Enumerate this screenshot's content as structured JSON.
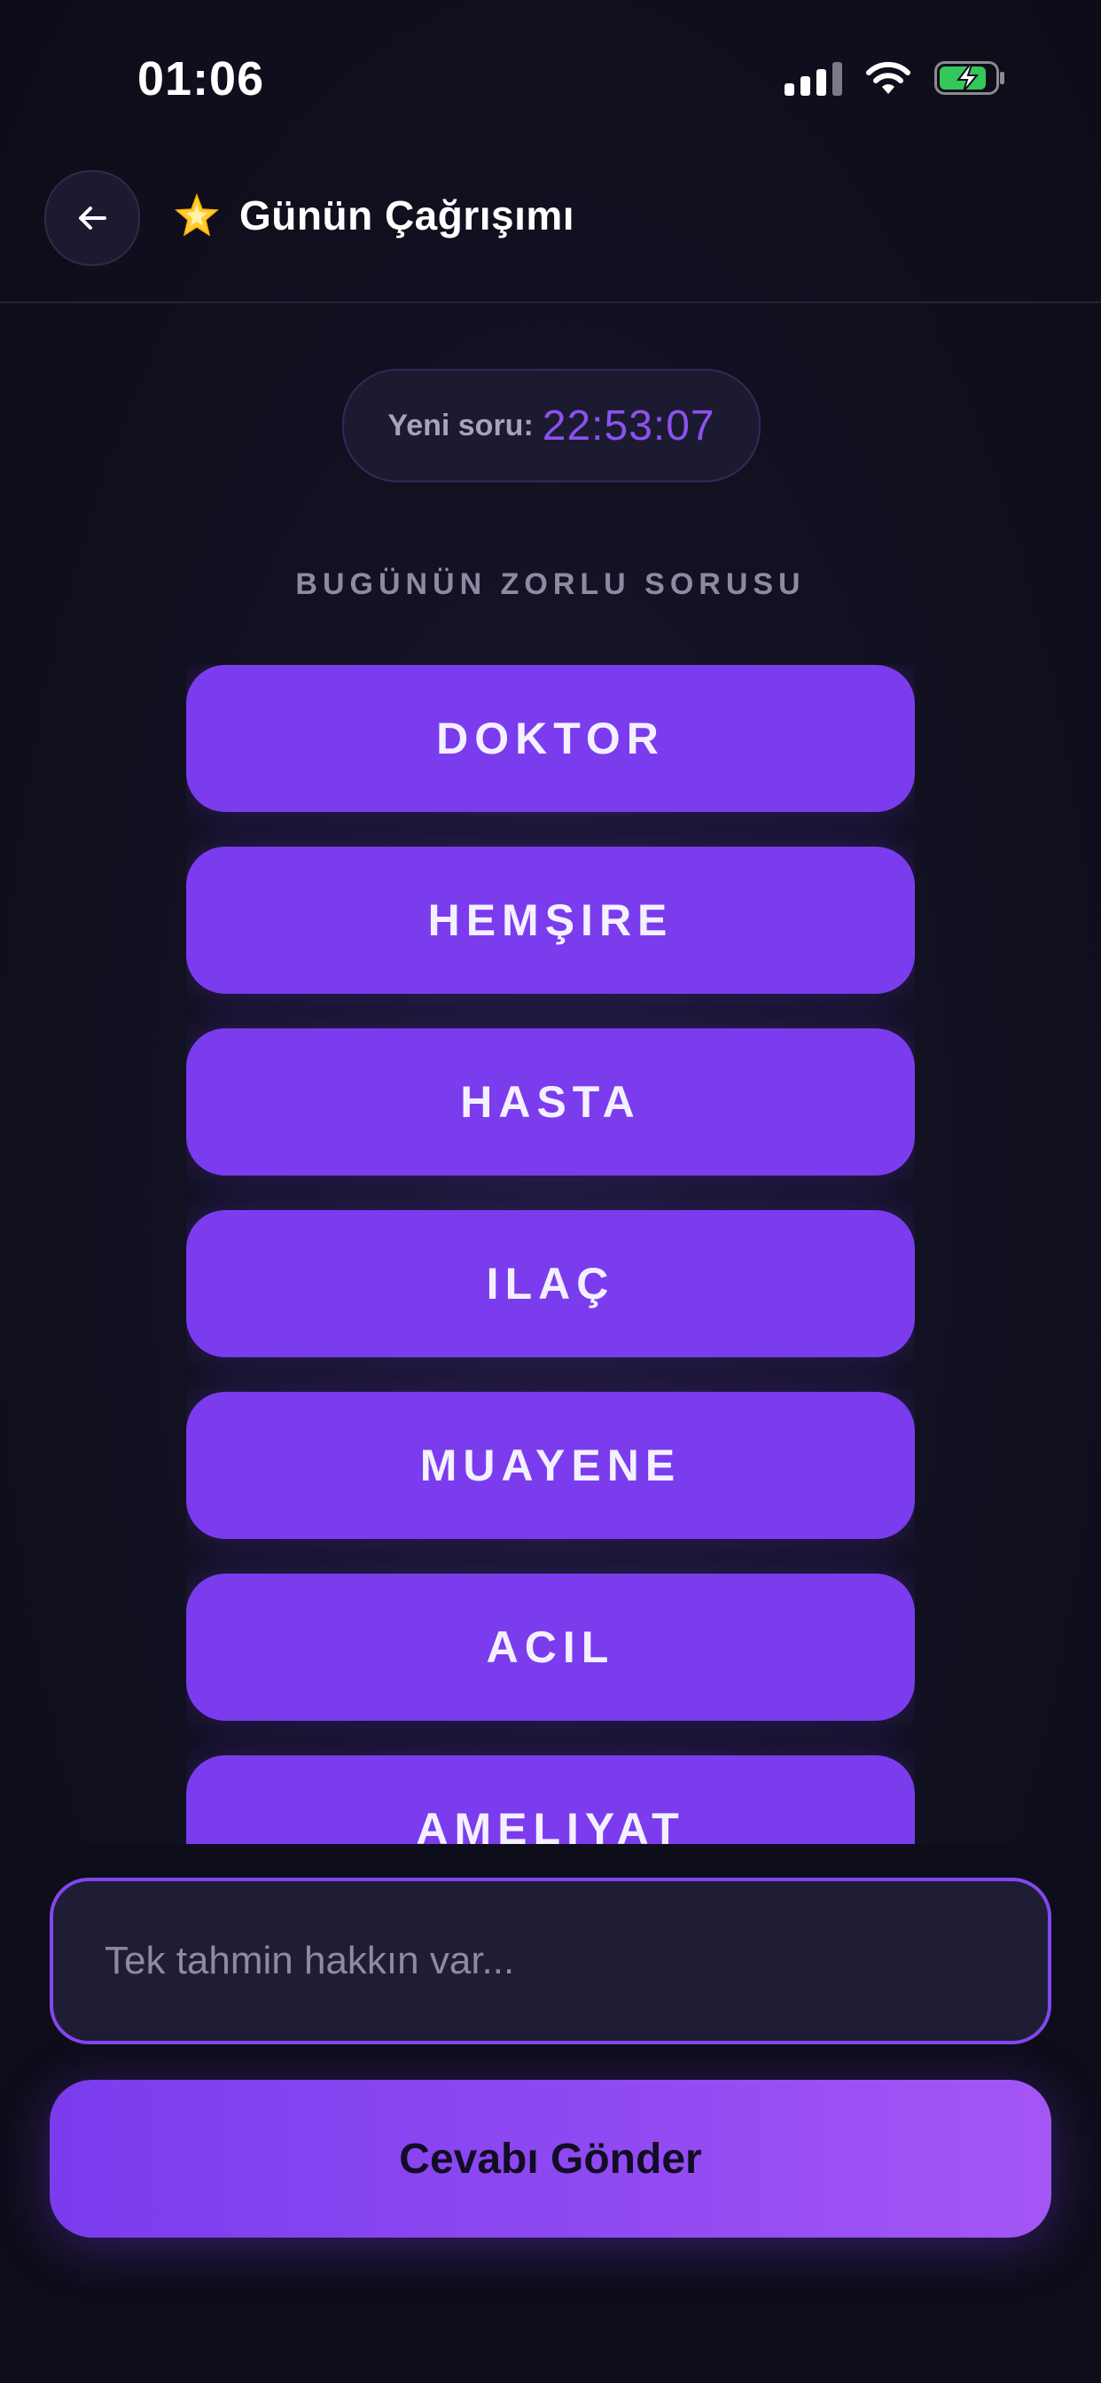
{
  "status_bar": {
    "time": "01:06",
    "icons": [
      "signal-icon",
      "wifi-icon",
      "battery-charging-icon"
    ],
    "battery_color": "#34c759"
  },
  "header": {
    "back_icon": "arrow-left-icon",
    "title_icon": "star-icon",
    "title": "Günün Çağrışımı"
  },
  "timer": {
    "label": "Yeni soru:",
    "value": "22:53:07"
  },
  "section_heading": "BUGÜNÜN ZORLU SORUSU",
  "words": [
    {
      "label": "DOKTOR"
    },
    {
      "label": "HEMŞIRE"
    },
    {
      "label": "HASTA"
    },
    {
      "label": "ILAÇ"
    },
    {
      "label": "MUAYENE"
    },
    {
      "label": "ACIL"
    },
    {
      "label": "AMELIYAT"
    }
  ],
  "answer": {
    "placeholder": "Tek tahmin hakkın var...",
    "value": ""
  },
  "submit": {
    "label": "Cevabı Gönder"
  },
  "colors": {
    "accent": "#7b3cee",
    "background": "#0f0e1c",
    "timer": "#8b52f0"
  }
}
